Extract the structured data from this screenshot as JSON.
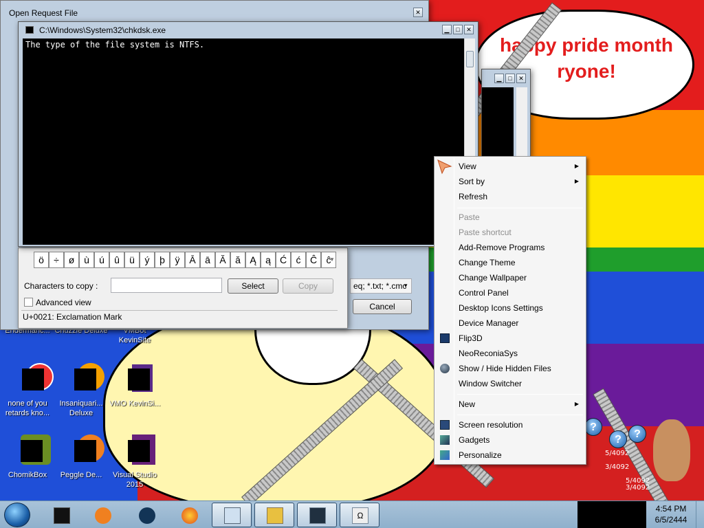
{
  "wallpaper": {
    "banner_line1": "happy pride month",
    "banner_line2": "ryone!",
    "colors": {
      "red": "#e31d1d",
      "orange": "#ff8a00",
      "yellow": "#ffe600",
      "green": "#1f9e2c",
      "blue": "#1f4fd8",
      "purple": "#6a1b9a"
    }
  },
  "open_request": {
    "title": "Open Request File",
    "filter": "eq; *.txt; *.cmc",
    "cancel": "Cancel"
  },
  "chkdsk": {
    "title": "C:\\Windows\\System32\\chkdsk.exe",
    "output": "The type of the file system is NTFS."
  },
  "charmap": {
    "chars": [
      "ö",
      "÷",
      "ø",
      "ù",
      "ú",
      "û",
      "ü",
      "ý",
      "þ",
      "ÿ",
      "Ā",
      "ā",
      "Ă",
      "ă",
      "Ą",
      "ą",
      "Ć",
      "ć",
      "Ĉ",
      "ĉ"
    ],
    "copy_label": "Characters to copy :",
    "copy_value": "",
    "select": "Select",
    "copy": "Copy",
    "advanced": "Advanced view",
    "status": "U+0021: Exclamation Mark"
  },
  "context_menu": {
    "view": "View",
    "sort_by": "Sort by",
    "refresh": "Refresh",
    "paste": "Paste",
    "paste_shortcut": "Paste shortcut",
    "add_remove": "Add-Remove Programs",
    "change_theme": "Change Theme",
    "change_wallpaper": "Change Wallpaper",
    "control_panel": "Control Panel",
    "desktop_icons": "Desktop Icons Settings",
    "device_manager": "Device Manager",
    "flip3d": "Flip3D",
    "neoreconia": "NeoReconiaSys",
    "show_hide": "Show / Hide Hidden Files",
    "window_switcher": "Window Switcher",
    "new": "New",
    "screen_resolution": "Screen resolution",
    "gadgets": "Gadgets",
    "personalize": "Personalize"
  },
  "desktop_icons": {
    "top_row": [
      {
        "label": "Endermanc..."
      },
      {
        "label": "Chuzzle Deluxe"
      },
      {
        "label": "VMBot KevinSite"
      }
    ],
    "row2": [
      {
        "label": "none of you retards kno..."
      },
      {
        "label": "Insaniquari... Deluxe"
      },
      {
        "label": "VMO KevinSi..."
      }
    ],
    "row3": [
      {
        "label": "ChomikBox"
      },
      {
        "label": "Peggle De..."
      },
      {
        "label": "Visual Studio 2015"
      }
    ]
  },
  "gadget_text": [
    "5/4092",
    "3/4092",
    "5/4092",
    "3/4092",
    "2/4092",
    "5/4092"
  ],
  "clock": {
    "time": "4:54 PM",
    "date": "6/5/2444"
  },
  "taskbar": {
    "items": [
      "cmd",
      "media-player",
      "steam",
      "firefox",
      "calculator",
      "keys",
      "chkdsk",
      "charmap"
    ]
  }
}
